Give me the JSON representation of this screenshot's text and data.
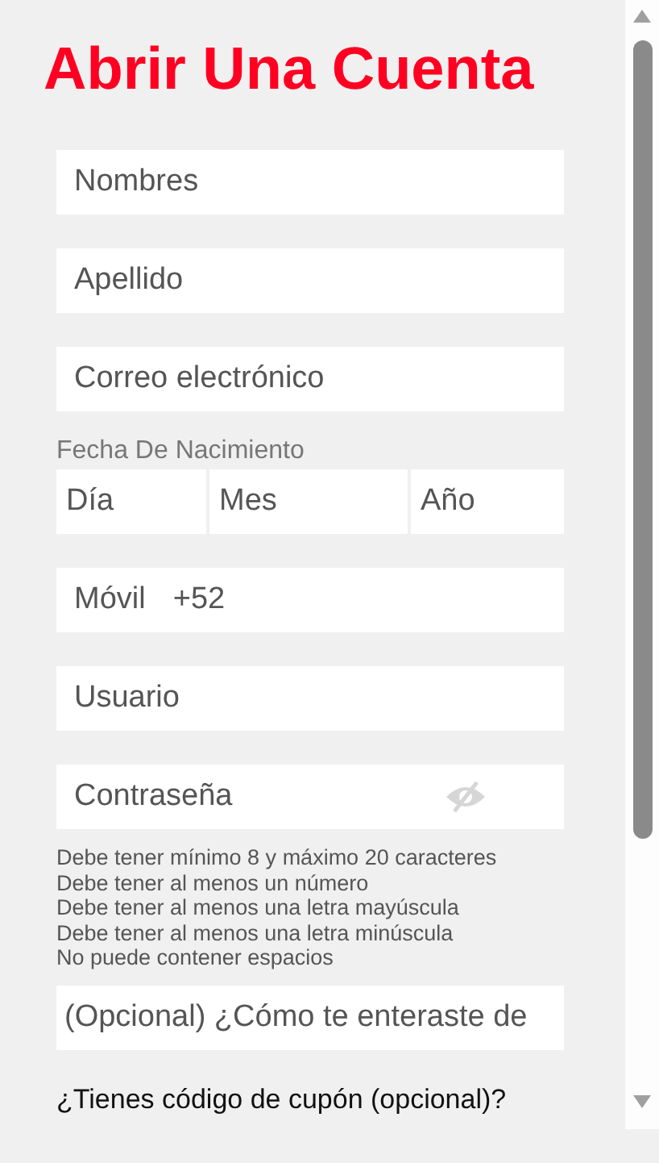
{
  "title": "Abrir Una Cuenta",
  "fields": [
    {
      "placeholder": "Nombres"
    },
    {
      "placeholder": "Apellido"
    },
    {
      "placeholder": "Correo electrónico"
    }
  ],
  "birth_date": {
    "label": "Fecha De Nacimiento",
    "parts": [
      {
        "placeholder": "Día"
      },
      {
        "placeholder": "Mes"
      },
      {
        "placeholder": "Año"
      }
    ]
  },
  "mobile": {
    "label": "Móvil",
    "prefix": "+52"
  },
  "username": {
    "placeholder": "Usuario"
  },
  "password": {
    "placeholder": "Contraseña",
    "rules": [
      "Debe tener mínimo 8 y máximo 20 caracteres",
      "Debe tener al menos un número",
      "Debe tener al menos una letra mayúscula",
      "Debe tener al menos una letra minúscula",
      "No puede contener espacios"
    ]
  },
  "referral": {
    "placeholder": "(Opcional) ¿Cómo te enteraste de"
  },
  "coupon_link": "¿Tienes código de cupón (opcional)?"
}
